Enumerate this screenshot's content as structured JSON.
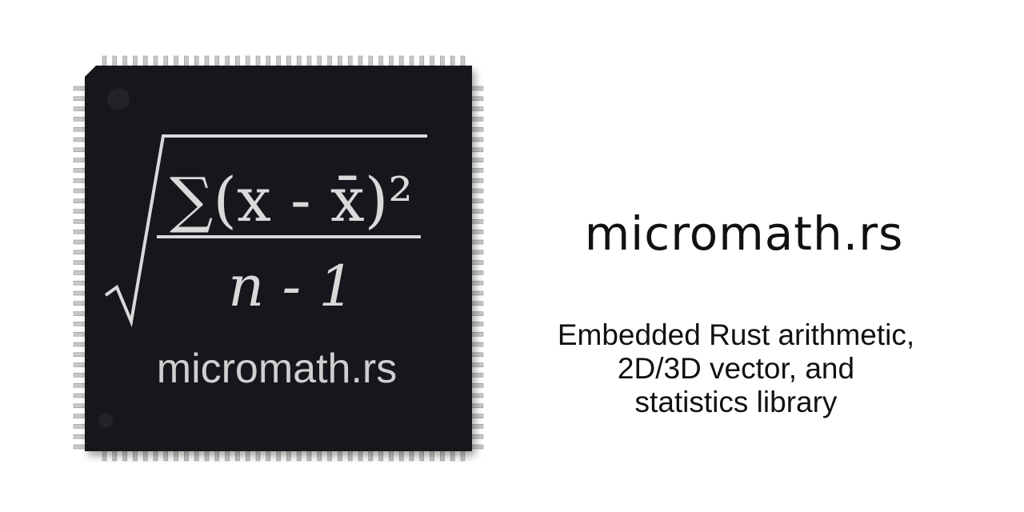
{
  "logo": {
    "chip_formula_numerator": "∑(x - x̄)²",
    "chip_formula_denominator": "n - 1",
    "chip_label": "micromath.rs"
  },
  "title": "micromath.rs",
  "subtitle_lines": [
    "Embedded Rust arithmetic,",
    "2D/3D vector, and",
    "statistics library"
  ],
  "colors": {
    "chip": "#16161c",
    "chip_text": "#d8d8d8",
    "pins": "#c9c9c9",
    "text": "#111111"
  }
}
